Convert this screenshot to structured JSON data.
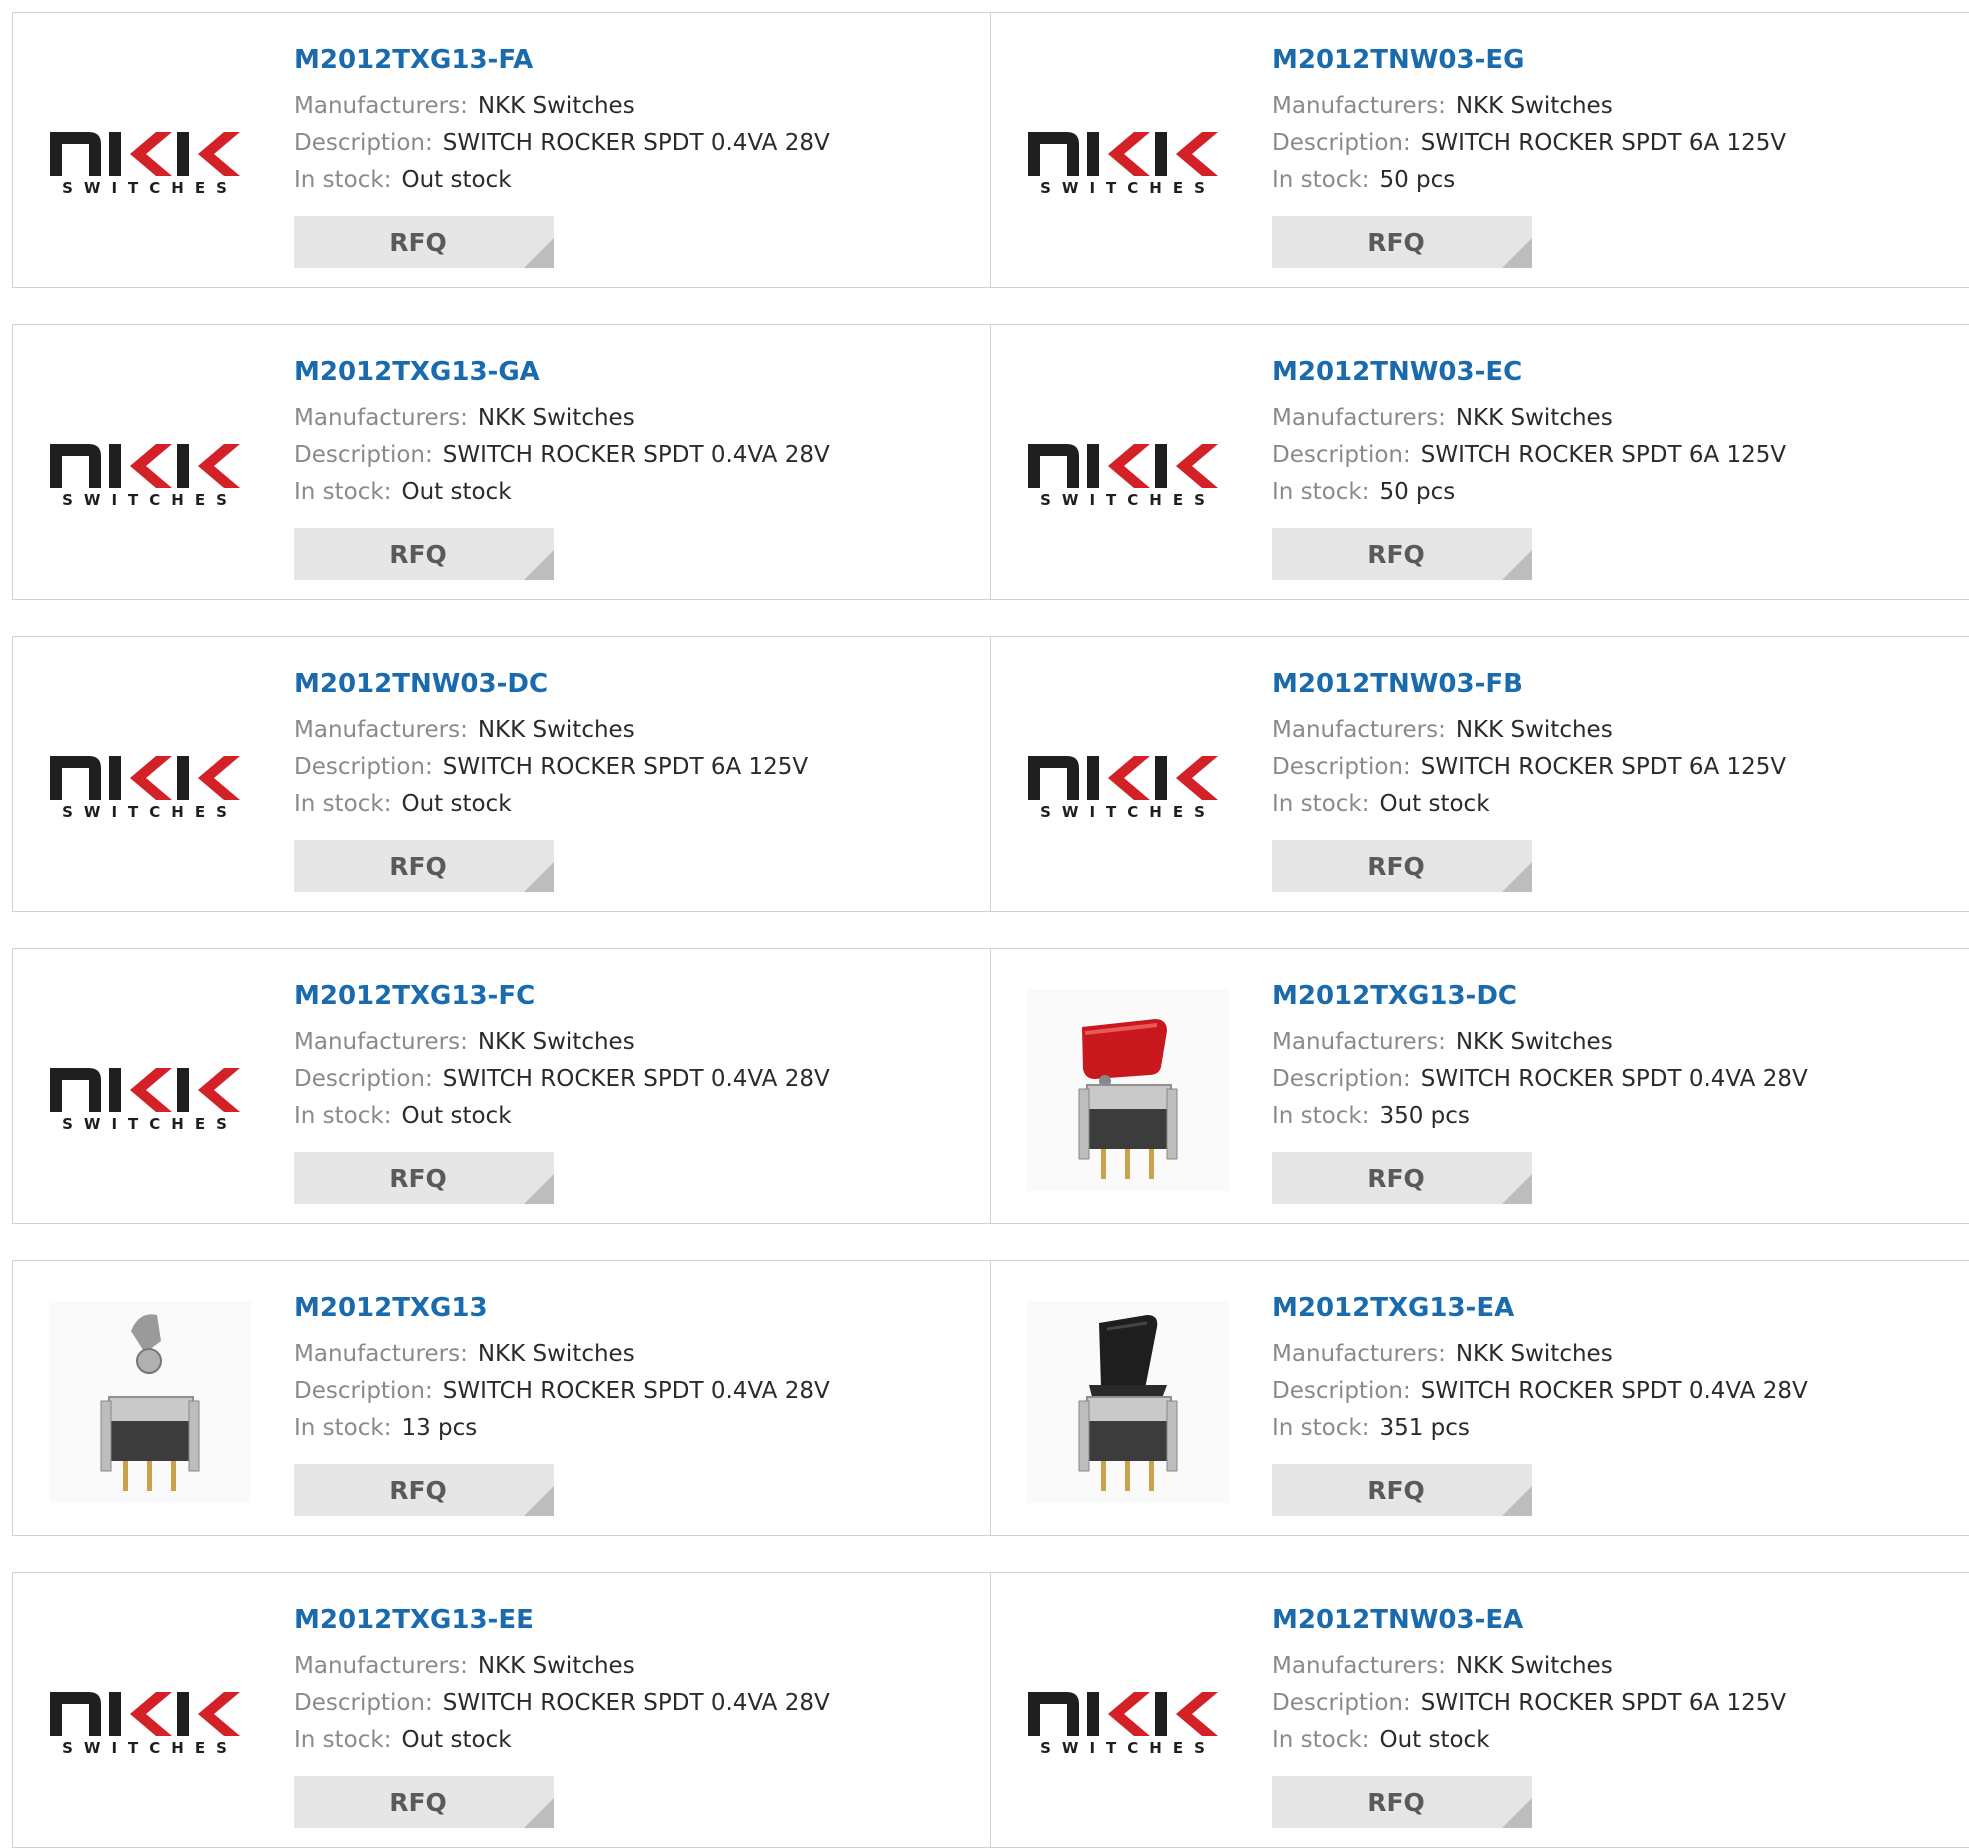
{
  "labels": {
    "manufacturers": "Manufacturers:",
    "description": "Description:",
    "in_stock": "In stock:",
    "rfq": "RFQ"
  },
  "brand_logo": {
    "mark": "NKK",
    "caption": "SWITCHES",
    "colors": {
      "dark": "#1f1f1f",
      "accent": "#d42027"
    }
  },
  "products": [
    {
      "part": "M2012TXG13-FA",
      "manufacturer": "NKK Switches",
      "description": "SWITCH ROCKER SPDT 0.4VA 28V",
      "stock": "Out stock",
      "image": "nkk-logo"
    },
    {
      "part": "M2012TNW03-EG",
      "manufacturer": "NKK Switches",
      "description": "SWITCH ROCKER SPDT 6A 125V",
      "stock": "50 pcs",
      "image": "nkk-logo"
    },
    {
      "part": "M2012TXG13-GA",
      "manufacturer": "NKK Switches",
      "description": "SWITCH ROCKER SPDT 0.4VA 28V",
      "stock": "Out stock",
      "image": "nkk-logo"
    },
    {
      "part": "M2012TNW03-EC",
      "manufacturer": "NKK Switches",
      "description": "SWITCH ROCKER SPDT 6A 125V",
      "stock": "50 pcs",
      "image": "nkk-logo"
    },
    {
      "part": "M2012TNW03-DC",
      "manufacturer": "NKK Switches",
      "description": "SWITCH ROCKER SPDT 6A 125V",
      "stock": "Out stock",
      "image": "nkk-logo"
    },
    {
      "part": "M2012TNW03-FB",
      "manufacturer": "NKK Switches",
      "description": "SWITCH ROCKER SPDT 6A 125V",
      "stock": "Out stock",
      "image": "nkk-logo"
    },
    {
      "part": "M2012TXG13-FC",
      "manufacturer": "NKK Switches",
      "description": "SWITCH ROCKER SPDT 0.4VA 28V",
      "stock": "Out stock",
      "image": "nkk-logo"
    },
    {
      "part": "M2012TXG13-DC",
      "manufacturer": "NKK Switches",
      "description": "SWITCH ROCKER SPDT 0.4VA 28V",
      "stock": "350 pcs",
      "image": "red-rocker-switch"
    },
    {
      "part": "M2012TXG13",
      "manufacturer": "NKK Switches",
      "description": "SWITCH ROCKER SPDT 0.4VA 28V",
      "stock": "13 pcs",
      "image": "metal-rocker-switch"
    },
    {
      "part": "M2012TXG13-EA",
      "manufacturer": "NKK Switches",
      "description": "SWITCH ROCKER SPDT 0.4VA 28V",
      "stock": "351 pcs",
      "image": "black-rocker-switch"
    },
    {
      "part": "M2012TXG13-EE",
      "manufacturer": "NKK Switches",
      "description": "SWITCH ROCKER SPDT 0.4VA 28V",
      "stock": "Out stock",
      "image": "nkk-logo"
    },
    {
      "part": "M2012TNW03-EA",
      "manufacturer": "NKK Switches",
      "description": "SWITCH ROCKER SPDT 6A 125V",
      "stock": "Out stock",
      "image": "nkk-logo"
    }
  ]
}
